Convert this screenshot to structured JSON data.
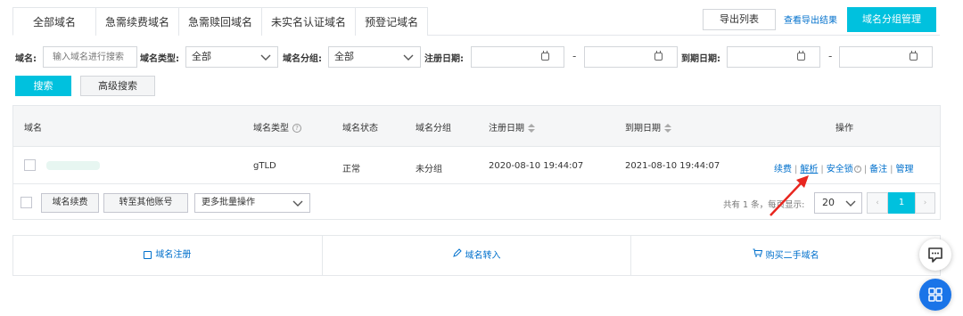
{
  "tabs": [
    {
      "label": "全部域名",
      "active": true
    },
    {
      "label": "急需续费域名"
    },
    {
      "label": "急需赎回域名"
    },
    {
      "label": "未实名认证域名"
    },
    {
      "label": "预登记域名"
    }
  ],
  "toolbar": {
    "export_label": "导出列表",
    "view_export_label": "查看导出结果",
    "group_manage_label": "域名分组管理"
  },
  "filters": {
    "domain_label": "域名:",
    "domain_placeholder": "输入域名进行搜索",
    "type_label": "域名类型:",
    "type_value": "全部",
    "group_label": "域名分组:",
    "group_value": "全部",
    "reg_date_label": "注册日期:",
    "exp_date_label": "到期日期:",
    "range_sep": "-",
    "search_label": "搜索",
    "advanced_label": "高级搜索"
  },
  "table": {
    "headers": {
      "domain": "域名",
      "type": "域名类型",
      "status": "域名状态",
      "group": "域名分组",
      "reg_date": "注册日期",
      "exp_date": "到期日期",
      "ops": "操作"
    },
    "rows": [
      {
        "type": "gTLD",
        "status": "正常",
        "group": "未分组",
        "reg_date": "2020-08-10 19:44:07",
        "exp_date": "2021-08-10 19:44:07"
      }
    ],
    "ops": {
      "renew": "续费",
      "resolve": "解析",
      "security_lock": "安全锁",
      "note": "备注",
      "manage": "管理",
      "sep": "|"
    }
  },
  "footer": {
    "renew_btn": "域名续费",
    "transfer_btn": "转至其他账号",
    "batch_label": "更多批量操作",
    "pagination_text": "共有 1 条，每页显示:",
    "page_size": "20",
    "prev": "‹",
    "current_page": "1",
    "next": "›"
  },
  "bottom_links": {
    "register": "域名注册",
    "transfer_in": "域名转入",
    "buy_second_hand": "购买二手域名"
  },
  "icons": {
    "help": "help-circle-icon",
    "chat": "chat-icon",
    "apps": "apps-grid-icon"
  },
  "colors": {
    "primary": "#00c1de",
    "link": "#0070cc",
    "annotation_arrow": "#e8261f",
    "app_button": "#1a74e8"
  }
}
